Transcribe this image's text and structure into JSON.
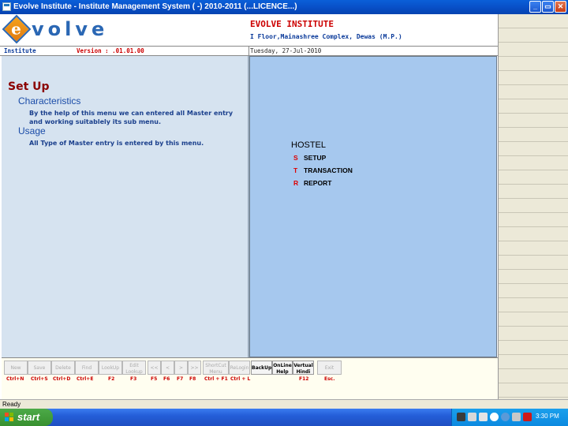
{
  "window": {
    "title": "Evolve Institute - Institute Management System ( -) 2010-2011 (...LICENCE...)",
    "controls": {
      "minimize": "_",
      "maximize": "▭",
      "close": "✕"
    }
  },
  "header": {
    "logo_letter": "e",
    "logo_text": "volve",
    "institute_name": "EVOLVE INSTITUTE",
    "institute_address": "I Floor,Mainashree Complex, Dewas (M.P.)"
  },
  "info": {
    "module": "Institute",
    "version": "Version : .01.01.00",
    "date": "Tuesday, 27-Jul-2010"
  },
  "left": {
    "title": "Set Up",
    "characteristics_heading": "Characteristics",
    "characteristics_text": "By the help of this menu we can entered all Master entry and working suitablely its sub menu.",
    "usage_heading": "Usage",
    "usage_text": "All Type of Master entry is entered by this menu."
  },
  "right": {
    "title": "HOSTEL",
    "menu": [
      {
        "key": "S",
        "label": "SETUP"
      },
      {
        "key": "T",
        "label": "TRANSACTION"
      },
      {
        "key": "R",
        "label": "REPORT"
      }
    ]
  },
  "toolbar": {
    "buttons": [
      {
        "label": "New",
        "enabled": false
      },
      {
        "label": "Save",
        "enabled": false
      },
      {
        "label": "Delete",
        "enabled": false
      },
      {
        "label": "Find",
        "enabled": false
      },
      {
        "label": "LookUp",
        "enabled": false
      },
      {
        "label": "Edit Lookup",
        "enabled": false
      },
      {
        "label": "<<",
        "enabled": false
      },
      {
        "label": "<",
        "enabled": false
      },
      {
        "label": ">",
        "enabled": false
      },
      {
        "label": ">>",
        "enabled": false
      },
      {
        "label": "ShortCut Menu",
        "enabled": false
      },
      {
        "label": "ReLogin",
        "enabled": false
      },
      {
        "label": "BackUp",
        "enabled": true
      },
      {
        "label": "OnLine Help",
        "enabled": true
      },
      {
        "label": "Vertual Hindi",
        "enabled": true
      },
      {
        "label": "Exit",
        "enabled": false
      }
    ],
    "shortcuts": [
      "Ctrl+N",
      "Ctrl+S",
      "Ctrl+D",
      "Ctrl+E",
      "F2",
      "F3",
      "F5",
      "F6",
      "F7",
      "F8",
      "Ctrl + F1",
      "Ctrl + L",
      "F12",
      "Esc."
    ]
  },
  "status": {
    "text": "Ready"
  },
  "taskbar": {
    "start_label": "start",
    "clock": "3:30 PM"
  }
}
